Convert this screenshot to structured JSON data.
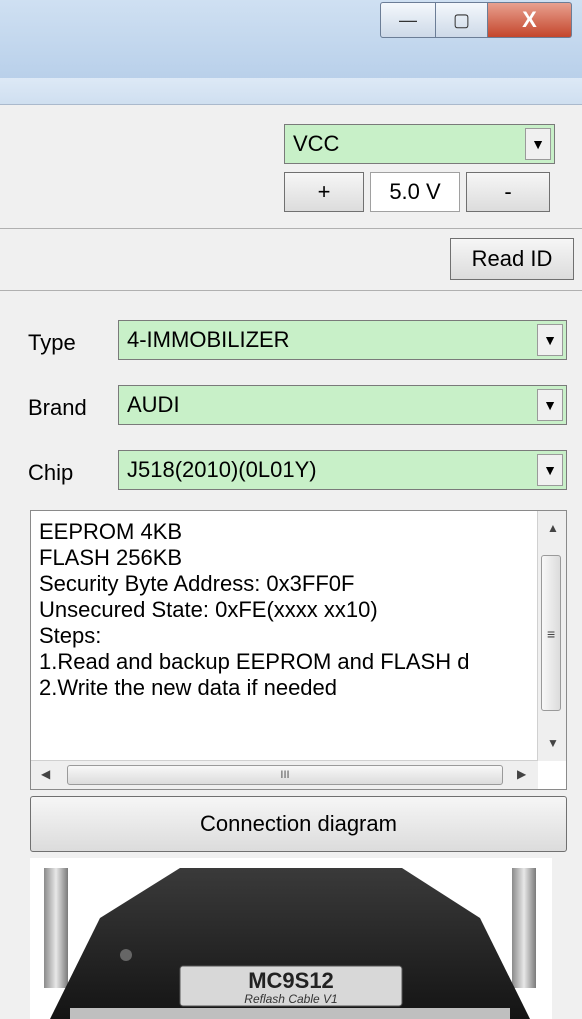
{
  "window": {
    "min_glyph": "—",
    "max_glyph": "▢",
    "close_glyph": "X"
  },
  "power": {
    "supply_value": "VCC",
    "plus_label": "+",
    "voltage": "5.0 V",
    "minus_label": "-"
  },
  "read_id_label": "Read ID",
  "selectors": {
    "type_label": "Type",
    "type_value": "4-IMMOBILIZER",
    "brand_label": "Brand",
    "brand_value": "AUDI",
    "chip_label": "Chip",
    "chip_value": "J518(2010)(0L01Y)"
  },
  "info_lines": [
    "EEPROM 4KB",
    "FLASH 256KB",
    "Security Byte Address: 0x3FF0F",
    "Unsecured State: 0xFE(xxxx xx10)",
    "Steps:",
    "1.Read and backup EEPROM and FLASH d",
    "2.Write the new data if needed"
  ],
  "scroll_grip": "III",
  "connection_diagram_label": "Connection diagram",
  "cable": {
    "label_main": "MC9S12",
    "label_sub": "Reflash Cable V1"
  },
  "colors": {
    "combo_bg": "#c8f0c8",
    "titlebar": "#b9d0ea",
    "close_button": "#c4462c"
  }
}
